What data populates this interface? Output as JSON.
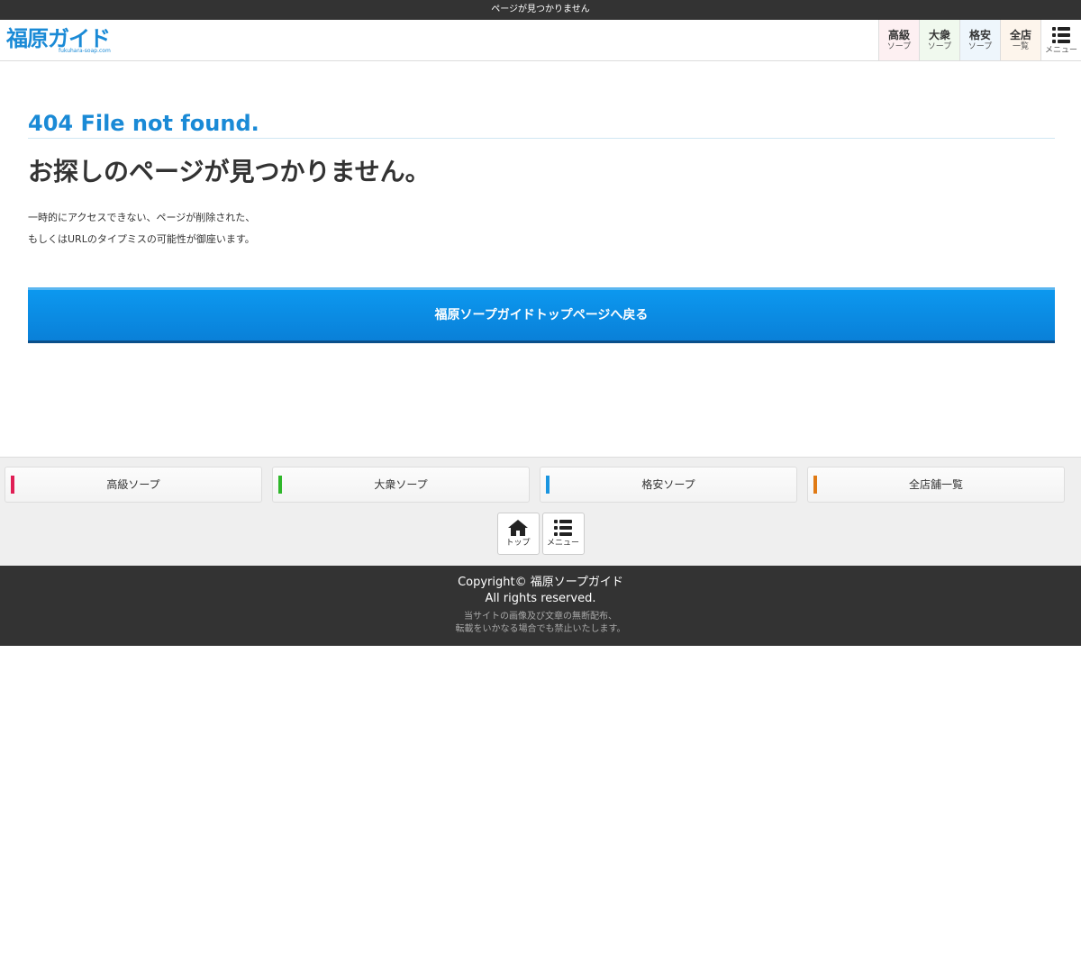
{
  "topbar": {
    "text": "ページが見つかりません"
  },
  "header": {
    "logo_text": "福原ガイド",
    "logo_sub": "fukuhara-soap.com",
    "nav": [
      {
        "line1": "高級",
        "line2": "ソープ"
      },
      {
        "line1": "大衆",
        "line2": "ソープ"
      },
      {
        "line1": "格安",
        "line2": "ソープ"
      },
      {
        "line1": "全店",
        "line2": "一覧"
      }
    ],
    "menu_label": "メニュー"
  },
  "main": {
    "error_title": "404 File not found.",
    "heading": "お探しのページが見つかりません。",
    "desc_line1": "一時的にアクセスできない、ページが削除された、",
    "desc_line2": "もしくはURLのタイプミスの可能性が御座います。",
    "back_button": "福原ソープガイドトップページへ戻る"
  },
  "footnav": {
    "categories": [
      {
        "label": "高級ソープ",
        "color": "#e01e55"
      },
      {
        "label": "大衆ソープ",
        "color": "#2fb72a"
      },
      {
        "label": "格安ソープ",
        "color": "#1a95e0"
      },
      {
        "label": "全店舗一覧",
        "color": "#e07a14"
      }
    ],
    "top_label": "トップ",
    "menu_label": "メニュー"
  },
  "footer": {
    "copyright": "Copyright© 福原ソープガイド",
    "rights": "All rights reserved.",
    "note_line1": "当サイトの画像及び文章の無断配布、",
    "note_line2": "転載をいかなる場合でも禁止いたします。"
  },
  "colors": {
    "brand_blue": "#1a8ad6",
    "dark_bar": "#333333",
    "button_blue": "#0a80d8"
  }
}
